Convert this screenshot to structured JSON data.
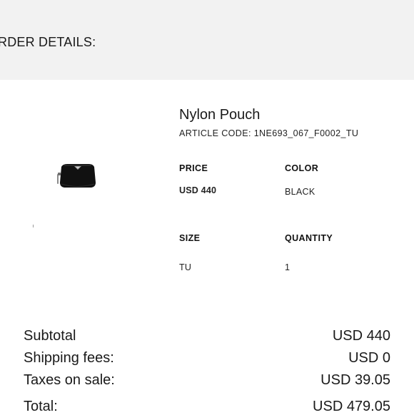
{
  "header": {
    "title": "RDER DETAILS:"
  },
  "product": {
    "name": "Nylon Pouch",
    "article_code": "ARTICLE CODE: 1NE693_067_F0002_TU",
    "image_icon": "black-nylon-pouch-thumbnail",
    "price_label": "PRICE",
    "price_value": "USD 440",
    "color_label": "COLOR",
    "color_value": "BLACK",
    "size_label": "SIZE",
    "size_value": "TU",
    "quantity_label": "QUANTITY",
    "quantity_value": "1"
  },
  "summary": {
    "subtotal_label": "Subtotal",
    "subtotal_value": "USD 440",
    "shipping_label": "Shipping fees:",
    "shipping_value": "USD 0",
    "taxes_label": "Taxes on sale:",
    "taxes_value": "USD 39.05",
    "total_label": "Total:",
    "total_value": "USD 479.05"
  },
  "colors": {
    "header_background": "#f2f2f2",
    "text": "#1a1a1a",
    "pouch": "#111111"
  }
}
